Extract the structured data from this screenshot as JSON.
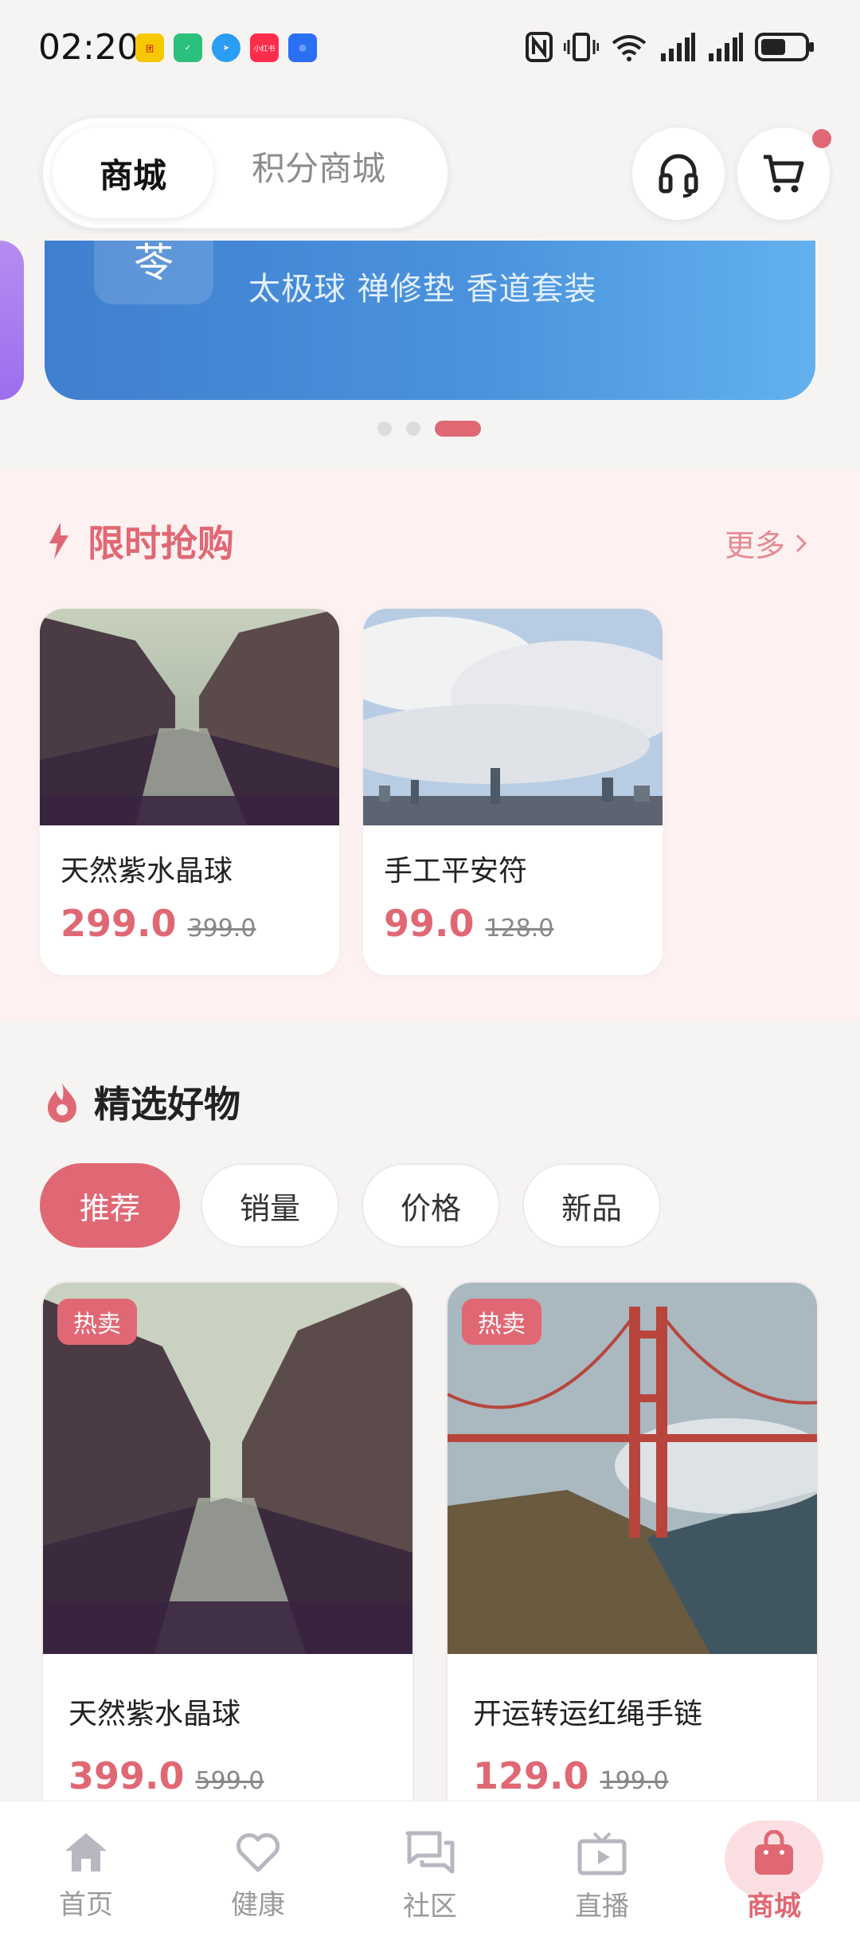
{
  "status_bar": {
    "time": "02:20",
    "app_icons": [
      {
        "name": "app-icon-1",
        "color": "#f7c700",
        "text": "团"
      },
      {
        "name": "app-icon-2",
        "color": "#2bc07b",
        "text": "✓"
      },
      {
        "name": "app-icon-3",
        "color": "#2a9df4",
        "text": "➤"
      },
      {
        "name": "app-icon-4",
        "color": "#ff2d4b",
        "text": "小红书"
      },
      {
        "name": "app-icon-5",
        "color": "#2a6ff4",
        "text": "◎"
      }
    ]
  },
  "header": {
    "tab_active": "商城",
    "tab_inactive": "积分商城"
  },
  "banner": {
    "subtitle": "太极球 禅修垫 香道套装",
    "icon_glyph": "苓"
  },
  "flash_sale": {
    "title": "限时抢购",
    "more": "更多",
    "items": [
      {
        "name": "天然紫水晶球",
        "price": "299.0",
        "original": "399.0",
        "image": "canal-street"
      },
      {
        "name": "手工平安符",
        "price": "99.0",
        "original": "128.0",
        "image": "city-skyline"
      }
    ]
  },
  "selected": {
    "title": "精选好物",
    "filters": [
      "推荐",
      "销量",
      "价格",
      "新品"
    ],
    "active_filter": "推荐",
    "products": [
      {
        "name": "天然紫水晶球",
        "price": "399.0",
        "original": "599.0",
        "badge": "热卖",
        "image": "canal-street"
      },
      {
        "name": "开运转运红绳手链",
        "price": "129.0",
        "original": "199.0",
        "badge": "热卖",
        "image": "golden-gate-bridge"
      }
    ]
  },
  "bottom_nav": {
    "items": [
      {
        "label": "首页",
        "icon": "home-icon"
      },
      {
        "label": "健康",
        "icon": "heart-icon"
      },
      {
        "label": "社区",
        "icon": "chat-icon"
      },
      {
        "label": "直播",
        "icon": "tv-icon"
      },
      {
        "label": "商城",
        "icon": "shopping-bag-icon"
      }
    ],
    "active": "商城"
  },
  "colors": {
    "accent": "#e06874",
    "banner_start": "#3f7fcf",
    "banner_end": "#62b1ee",
    "flash_bg": "#fdf1f1",
    "page_bg": "#f6f4f3"
  }
}
